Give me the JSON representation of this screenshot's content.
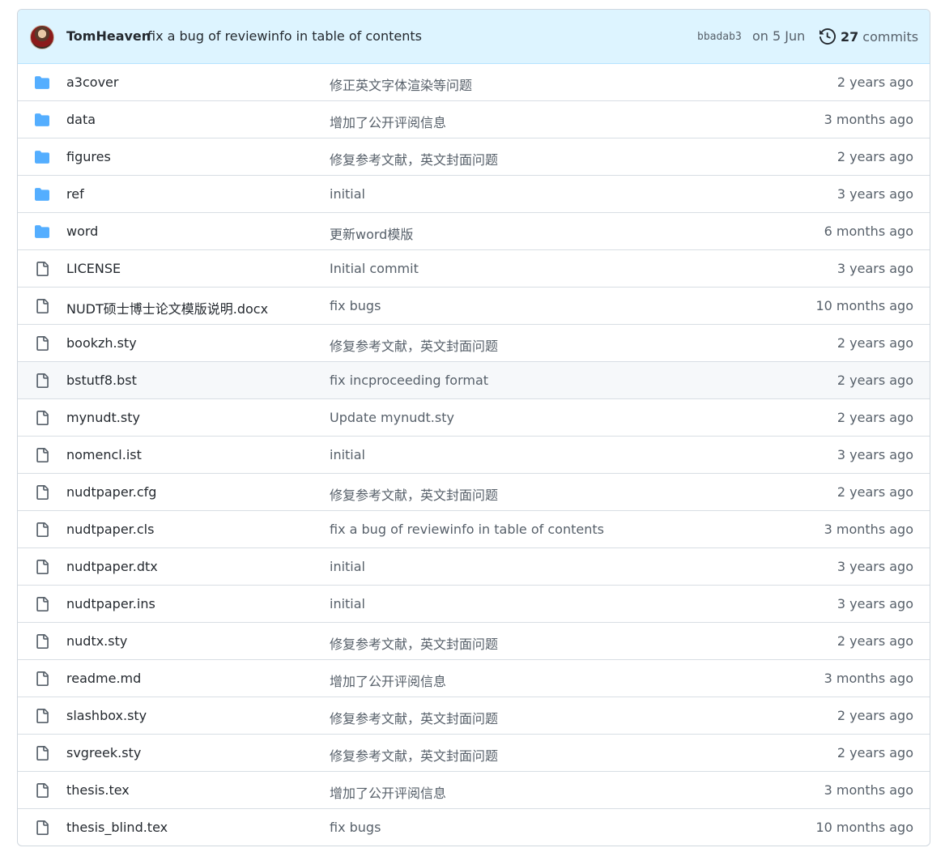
{
  "latest_commit": {
    "author": "TomHeaven",
    "message": "fix a bug of reviewinfo in table of contents",
    "sha": "bbadab3",
    "date": "on 5 Jun",
    "commit_count": "27",
    "commits_label": "commits",
    "history_icon": "history-icon"
  },
  "colors": {
    "folder": "#54aeff",
    "file": "#57606a",
    "commit_bar_bg": "#ddf4ff"
  },
  "files": [
    {
      "type": "dir",
      "icon": "folder-icon",
      "name": "a3cover",
      "message": "修正英文字体渲染等问题",
      "age": "2 years ago"
    },
    {
      "type": "dir",
      "icon": "folder-icon",
      "name": "data",
      "message": "增加了公开评阅信息",
      "age": "3 months ago"
    },
    {
      "type": "dir",
      "icon": "folder-icon",
      "name": "figures",
      "message": "修复参考文献，英文封面问题",
      "age": "2 years ago"
    },
    {
      "type": "dir",
      "icon": "folder-icon",
      "name": "ref",
      "message": "initial",
      "age": "3 years ago"
    },
    {
      "type": "dir",
      "icon": "folder-icon",
      "name": "word",
      "message": "更新word模版",
      "age": "6 months ago"
    },
    {
      "type": "file",
      "icon": "file-icon",
      "name": "LICENSE",
      "message": "Initial commit",
      "age": "3 years ago"
    },
    {
      "type": "file",
      "icon": "file-icon",
      "name": "NUDT硕士博士论文模版说明.docx",
      "message": "fix bugs",
      "age": "10 months ago"
    },
    {
      "type": "file",
      "icon": "file-icon",
      "name": "bookzh.sty",
      "message": "修复参考文献，英文封面问题",
      "age": "2 years ago"
    },
    {
      "type": "file",
      "icon": "file-icon",
      "name": "bstutf8.bst",
      "message": "fix incproceeding format",
      "age": "2 years ago",
      "hover": true
    },
    {
      "type": "file",
      "icon": "file-icon",
      "name": "mynudt.sty",
      "message": "Update mynudt.sty",
      "age": "2 years ago"
    },
    {
      "type": "file",
      "icon": "file-icon",
      "name": "nomencl.ist",
      "message": "initial",
      "age": "3 years ago"
    },
    {
      "type": "file",
      "icon": "file-icon",
      "name": "nudtpaper.cfg",
      "message": "修复参考文献，英文封面问题",
      "age": "2 years ago"
    },
    {
      "type": "file",
      "icon": "file-icon",
      "name": "nudtpaper.cls",
      "message": "fix a bug of reviewinfo in table of contents",
      "age": "3 months ago"
    },
    {
      "type": "file",
      "icon": "file-icon",
      "name": "nudtpaper.dtx",
      "message": "initial",
      "age": "3 years ago"
    },
    {
      "type": "file",
      "icon": "file-icon",
      "name": "nudtpaper.ins",
      "message": "initial",
      "age": "3 years ago"
    },
    {
      "type": "file",
      "icon": "file-icon",
      "name": "nudtx.sty",
      "message": "修复参考文献，英文封面问题",
      "age": "2 years ago"
    },
    {
      "type": "file",
      "icon": "file-icon",
      "name": "readme.md",
      "message": "增加了公开评阅信息",
      "age": "3 months ago"
    },
    {
      "type": "file",
      "icon": "file-icon",
      "name": "slashbox.sty",
      "message": "修复参考文献，英文封面问题",
      "age": "2 years ago"
    },
    {
      "type": "file",
      "icon": "file-icon",
      "name": "svgreek.sty",
      "message": "修复参考文献，英文封面问题",
      "age": "2 years ago"
    },
    {
      "type": "file",
      "icon": "file-icon",
      "name": "thesis.tex",
      "message": "增加了公开评阅信息",
      "age": "3 months ago"
    },
    {
      "type": "file",
      "icon": "file-icon",
      "name": "thesis_blind.tex",
      "message": "fix bugs",
      "age": "10 months ago"
    }
  ]
}
